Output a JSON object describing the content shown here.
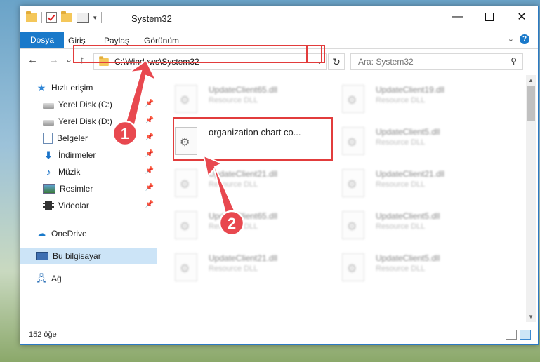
{
  "window": {
    "title": "System32",
    "min_glyph": "—",
    "close_glyph": "✕"
  },
  "ribbon": {
    "tabs": [
      "Dosya",
      "Giriş",
      "Paylaş",
      "Görünüm"
    ],
    "help": "?"
  },
  "nav": {
    "back": "←",
    "forward": "→",
    "recent": "⌄",
    "up": "↑",
    "address": "C:\\Windows\\System32",
    "refresh": "↻",
    "search_placeholder": "Ara: System32"
  },
  "sidebar": {
    "items": [
      {
        "label": "Hızlı erişim",
        "icon": "star-icon",
        "pinned": false
      },
      {
        "label": "Yerel Disk (C:)",
        "icon": "drive-icon",
        "pinned": true
      },
      {
        "label": "Yerel Disk (D:)",
        "icon": "drive-icon",
        "pinned": true
      },
      {
        "label": "Belgeler",
        "icon": "documents-icon",
        "pinned": true
      },
      {
        "label": "İndirmeler",
        "icon": "download-icon",
        "pinned": true
      },
      {
        "label": "Müzik",
        "icon": "music-icon",
        "pinned": true
      },
      {
        "label": "Resimler",
        "icon": "pictures-icon",
        "pinned": true
      },
      {
        "label": "Videolar",
        "icon": "videos-icon",
        "pinned": true
      },
      {
        "label": "OneDrive",
        "icon": "cloud-icon",
        "pinned": false
      },
      {
        "label": "Bu bilgisayar",
        "icon": "computer-icon",
        "pinned": false,
        "selected": true
      },
      {
        "label": "Ağ",
        "icon": "network-icon",
        "pinned": false
      }
    ]
  },
  "files": [
    {
      "name": "UpdateClient65.dll",
      "type": "Resource DLL",
      "blurred": true
    },
    {
      "name": "UpdateClient19.dll",
      "type": "Resource DLL",
      "blurred": true
    },
    {
      "name": "organization chart co...",
      "type": "",
      "blurred": false,
      "highlighted": true
    },
    {
      "name": "UpdateClient5.dll",
      "type": "Resource DLL",
      "blurred": true
    },
    {
      "name": "UpdateClient21.dll",
      "type": "Resource DLL",
      "blurred": true
    },
    {
      "name": "UpdateClient21.dll",
      "type": "Resource DLL",
      "blurred": true
    },
    {
      "name": "UpdateClient65.dll",
      "type": "Resource DLL",
      "blurred": true
    },
    {
      "name": "UpdateClient5.dll",
      "type": "Resource DLL",
      "blurred": true
    },
    {
      "name": "UpdateClient21.dll",
      "type": "Resource DLL",
      "blurred": true
    },
    {
      "name": "UpdateClient5.dll",
      "type": "Resource DLL",
      "blurred": true
    }
  ],
  "status": {
    "item_count": "152 öğe"
  },
  "annotations": {
    "step1": "1",
    "step2": "2",
    "arrow_color": "#e8484f",
    "highlight_color": "#e23c3c"
  }
}
